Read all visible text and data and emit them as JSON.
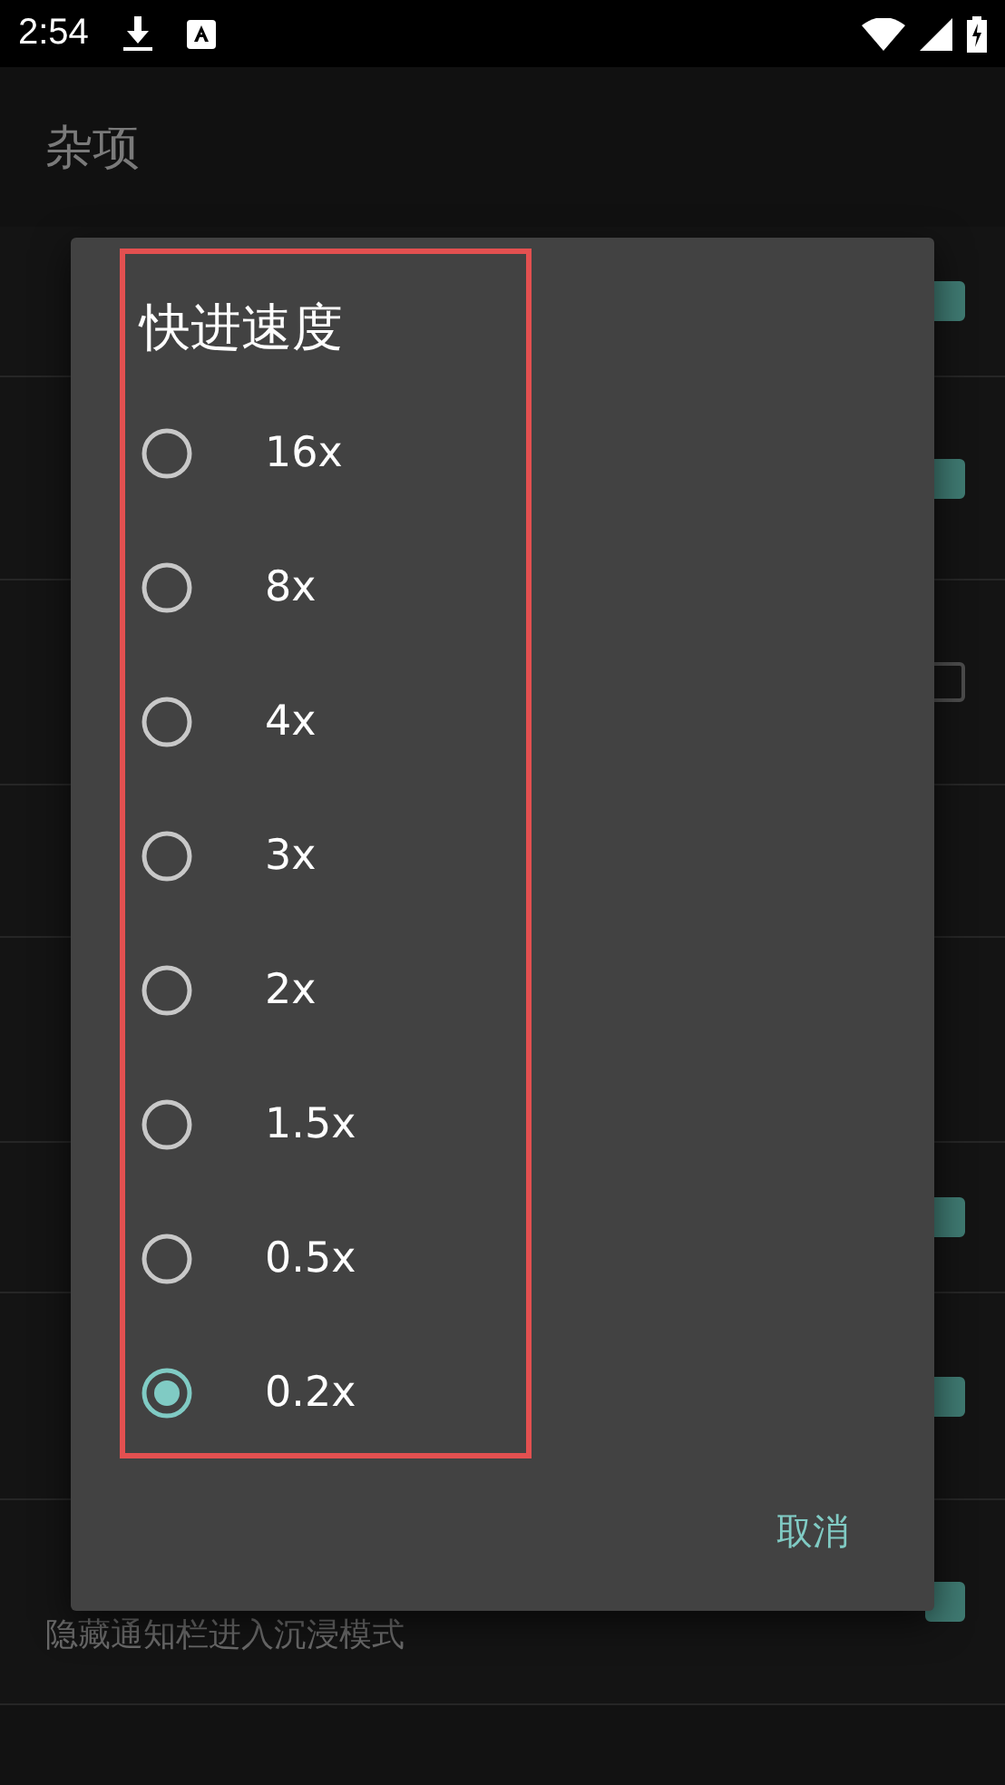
{
  "status_bar": {
    "time": "2:54"
  },
  "header": {
    "title": "杂项"
  },
  "settings": [
    {
      "kind": "checkbox",
      "checked": true
    },
    {
      "kind": "checkbox",
      "checked": true
    },
    {
      "kind": "checkbox",
      "checked": false
    },
    {
      "kind": "plain"
    },
    {
      "kind": "plain"
    },
    {
      "kind": "checkbox",
      "checked": true
    },
    {
      "kind": "checkbox",
      "checked": true
    },
    {
      "kind": "checkbox",
      "subtitle": "隐藏通知栏进入沉浸模式",
      "checked": true
    }
  ],
  "dialog": {
    "title": "快进速度",
    "options": [
      {
        "label": "16x",
        "selected": false
      },
      {
        "label": "8x",
        "selected": false
      },
      {
        "label": "4x",
        "selected": false
      },
      {
        "label": "3x",
        "selected": false
      },
      {
        "label": "2x",
        "selected": false
      },
      {
        "label": "1.5x",
        "selected": false
      },
      {
        "label": "0.5x",
        "selected": false
      },
      {
        "label": "0.2x",
        "selected": true
      }
    ],
    "cancel": "取消",
    "highlighted": true
  }
}
